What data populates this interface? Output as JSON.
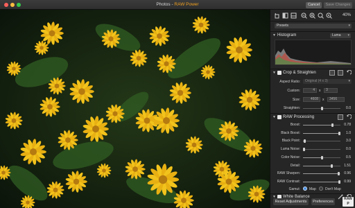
{
  "window": {
    "title_prefix": "Photos - ",
    "title_accent": "RAW Power",
    "cancel_label": "Cancel",
    "save_label": "Save Changes"
  },
  "toolbar": {
    "zoom": "40%"
  },
  "presets": {
    "label": "Presets"
  },
  "histogram": {
    "title": "Histogram",
    "mode": "Luma"
  },
  "crop": {
    "title": "Crop & Straighten",
    "aspect_label": "Aspect Ratio:",
    "aspect_value": "Original (4 x 3)",
    "custom_label": "Custom:",
    "custom_w": "4",
    "custom_x": "x",
    "custom_h": "3",
    "size_label": "Size:",
    "size_w": "4608",
    "size_x": "x",
    "size_h": "3456",
    "straighten_label": "Straighten:",
    "straighten_value": "0.0"
  },
  "raw": {
    "title": "RAW Processing",
    "rows": [
      {
        "label": "Boost:",
        "value": "0.78",
        "level": 0.78
      },
      {
        "label": "Black Boost:",
        "value": "1.0",
        "level": 1.0
      },
      {
        "label": "Black Point:",
        "value": "3.0",
        "level": 0.05
      },
      {
        "label": "Luma Noise:",
        "value": "0.0",
        "level": 0.0
      },
      {
        "label": "Color Noise:",
        "value": "0.5",
        "level": 0.5
      },
      {
        "label": "Detail:",
        "value": "1.51",
        "level": 0.76
      },
      {
        "label": "RAW Sharpen:",
        "value": "0.96",
        "level": 0.96
      },
      {
        "label": "RAW Contrast:",
        "value": "0.99",
        "level": 0.99
      }
    ],
    "gamut_label": "Gamut:",
    "gamut_opt1": "Map",
    "gamut_opt2": "Don't Map"
  },
  "white_balance": {
    "title": "White Balance"
  },
  "footer": {
    "reset_label": "Reset Adjustments",
    "prefs_label": "Preferences",
    "logo_line1": "RAW",
    "logo_line2": "P"
  }
}
